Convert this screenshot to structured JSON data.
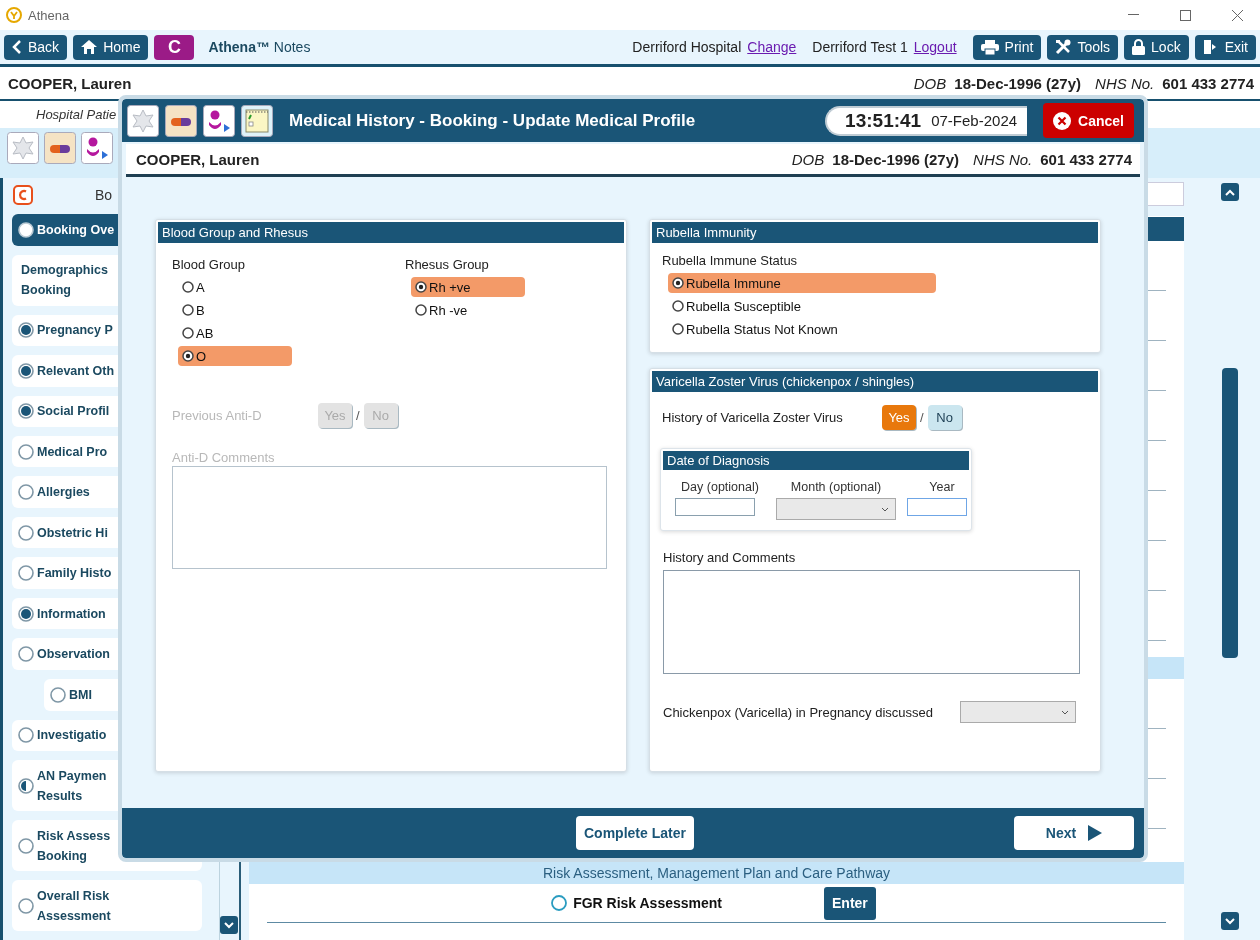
{
  "window": {
    "title": "Athena"
  },
  "toolbar": {
    "nav": [
      {
        "kind": "back",
        "label": "Back"
      },
      {
        "kind": "home",
        "label": "Home"
      }
    ],
    "badge": "C",
    "app_name": "**Athena™** Notes",
    "location": "Derriford Hospital",
    "location_link": "Change",
    "user": "Derriford Test 1",
    "user_link": "Logout",
    "actions": [
      {
        "kind": "print",
        "label": "Print"
      },
      {
        "kind": "tools",
        "label": "Tools"
      },
      {
        "kind": "lock",
        "label": "Lock"
      },
      {
        "kind": "exit",
        "label": "Exit"
      }
    ]
  },
  "patient": {
    "name": "COOPER, Lauren",
    "dob_label": "DOB",
    "dob": "18-Dec-1996 (27y)",
    "nhs_label": "NHS No.",
    "nhs": "601 433 2774"
  },
  "subtitle": "Hospital Patie",
  "sidebar": {
    "header": "Bo",
    "items": [
      {
        "label": "Booking Ove",
        "kind": "empty",
        "selected": true
      },
      {
        "label": "Demographics\nBooking",
        "kind": "plain",
        "selected": false
      },
      {
        "label": "Pregnancy P",
        "kind": "complete",
        "selected": false
      },
      {
        "label": "Relevant Oth",
        "kind": "complete",
        "selected": false
      },
      {
        "label": "Social Profil",
        "kind": "complete",
        "selected": false
      },
      {
        "label": "Medical Pro",
        "kind": "empty",
        "selected": false
      },
      {
        "label": "Allergies",
        "kind": "empty",
        "selected": false
      },
      {
        "label": "Obstetric Hi",
        "kind": "empty",
        "selected": false
      },
      {
        "label": "Family Histo",
        "kind": "empty",
        "selected": false
      },
      {
        "label": "Information",
        "kind": "complete",
        "selected": false
      },
      {
        "label": "Observation",
        "kind": "empty",
        "selected": false,
        "children": [
          {
            "label": "BMI",
            "kind": "empty",
            "selected": false
          }
        ]
      },
      {
        "label": "Investigatio",
        "kind": "empty",
        "selected": false
      },
      {
        "label": "AN Paymen\nResults",
        "kind": "partial",
        "selected": false
      },
      {
        "label": "Risk Assess\nBooking",
        "kind": "empty",
        "selected": false
      },
      {
        "label": "Overall Risk\nAssessment",
        "kind": "empty",
        "selected": false
      }
    ]
  },
  "content": {
    "band": "Risk Assessment, Management Plan and Care Pathway",
    "rows": [
      {
        "label": "FGR Risk Assessment",
        "button": "Enter"
      }
    ]
  },
  "dialog": {
    "title": "Medical History - Booking - Update Medical Profile",
    "time": "13:51:41",
    "date": "07-Feb-2024",
    "cancel": "Cancel",
    "patient": {
      "name": "COOPER, Lauren",
      "dob_label": "DOB",
      "dob": "18-Dec-1996 (27y)",
      "nhs_label": "NHS No.",
      "nhs": "601 433 2774"
    },
    "blood": {
      "title": "Blood Group and Rhesus",
      "blood_group": {
        "label": "Blood Group",
        "options": [
          {
            "label": "A",
            "selected": false
          },
          {
            "label": "B",
            "selected": false
          },
          {
            "label": "AB",
            "selected": false
          },
          {
            "label": "O",
            "selected": true
          }
        ]
      },
      "rhesus": {
        "label": "Rhesus Group",
        "options": [
          {
            "label": "Rh +ve",
            "selected": true
          },
          {
            "label": "Rh -ve",
            "selected": false
          }
        ]
      },
      "anti_d": {
        "label": "Previous Anti-D",
        "disabled": true,
        "separator": "/",
        "options": [
          {
            "label": "Yes",
            "selected": false
          },
          {
            "label": "No",
            "selected": false
          }
        ]
      },
      "comments": {
        "label": "Anti-D Comments",
        "disabled": true
      }
    },
    "rubella": {
      "title": "Rubella Immunity",
      "label": "Rubella Immune Status",
      "options": [
        {
          "label": "Rubella Immune",
          "selected": true
        },
        {
          "label": "Rubella Susceptible",
          "selected": false
        },
        {
          "label": "Rubella Status Not Known",
          "selected": false
        }
      ]
    },
    "varicella": {
      "title": "Varicella Zoster Virus (chickenpox / shingles)",
      "history": {
        "label": "History of Varicella Zoster Virus",
        "disabled": false,
        "separator": "/",
        "options": [
          {
            "label": "Yes",
            "selected": true
          },
          {
            "label": "No",
            "selected": false
          }
        ]
      },
      "diagnosis": {
        "title": "Date of Diagnosis",
        "day": "Day (optional)",
        "month": "Month (optional)",
        "year": "Year"
      },
      "comments": {
        "label": "History and Comments",
        "disabled": false
      },
      "discussed": {
        "label": "Chickenpox (Varicella) in Pregnancy discussed"
      }
    },
    "footer": {
      "complete_later": "Complete Later",
      "next": "Next"
    }
  }
}
